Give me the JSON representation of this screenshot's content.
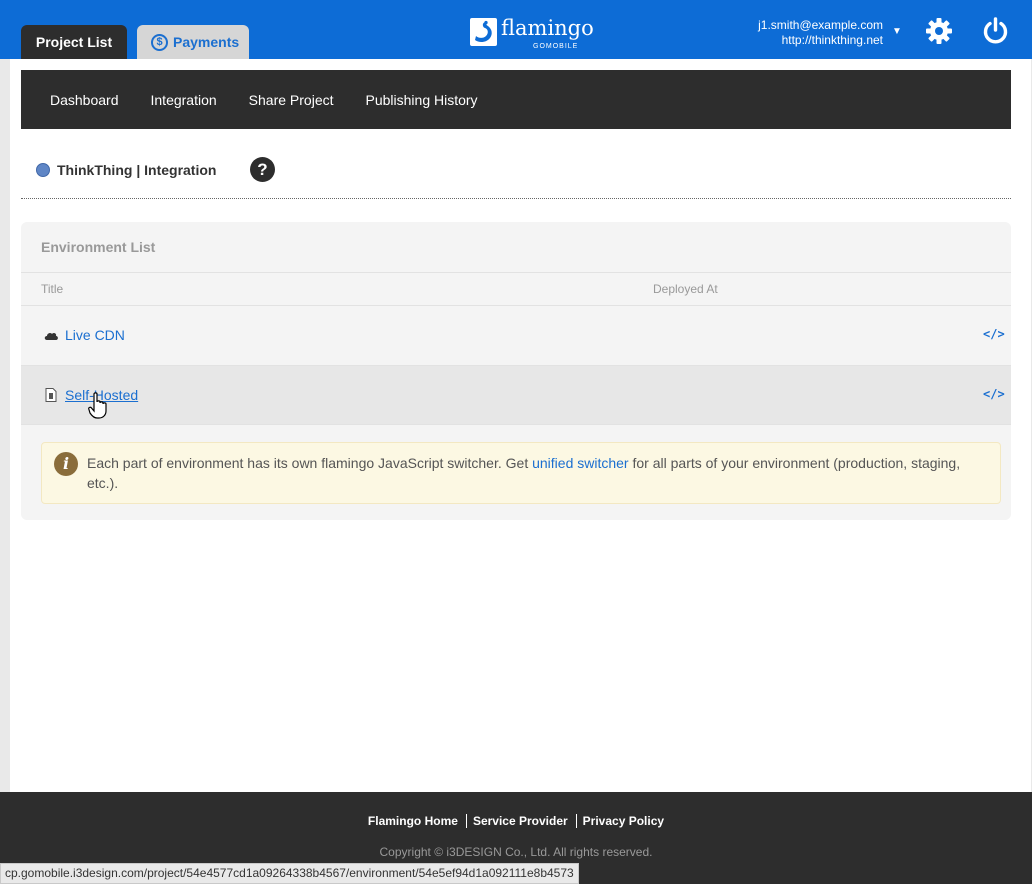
{
  "tabs": {
    "project_list": "Project List",
    "payments": "Payments",
    "payments_icon": "dollar-circle-icon"
  },
  "brand": {
    "name": "flamingo",
    "sub": "GOMOBILE"
  },
  "account": {
    "email": "j1.smith@example.com",
    "site": "http://thinkthing.net"
  },
  "subnav": {
    "items": [
      "Dashboard",
      "Integration",
      "Share Project",
      "Publishing History"
    ]
  },
  "page": {
    "title": "ThinkThing | Integration",
    "help": "?"
  },
  "panel": {
    "title": "Environment List",
    "columns": [
      "Title",
      "Deployed At"
    ],
    "rows": [
      {
        "title": "Live CDN",
        "icon": "cloud-icon",
        "deployed_at": ""
      },
      {
        "title": "Self-Hosted",
        "icon": "file-icon",
        "deployed_at": ""
      }
    ],
    "code_label": "</>"
  },
  "alert": {
    "before": "Each part of environment has its own flamingo JavaScript switcher. Get ",
    "link": "unified switcher",
    "after": " for all parts of your environment (production, staging, etc.)."
  },
  "footer": {
    "links": [
      "Flamingo Home",
      "Service Provider",
      "Privacy Policy"
    ],
    "copyright": "Copyright © i3DESIGN Co., Ltd. All rights reserved."
  },
  "status_url": "cp.gomobile.i3design.com/project/54e4577cd1a09264338b4567/environment/54e5ef94d1a092111e8b4573",
  "colors": {
    "topbar": "#0d6cd6",
    "dark": "#2d2d2d",
    "link": "#1b6fd0",
    "alert_bg": "#fcf8e3"
  }
}
